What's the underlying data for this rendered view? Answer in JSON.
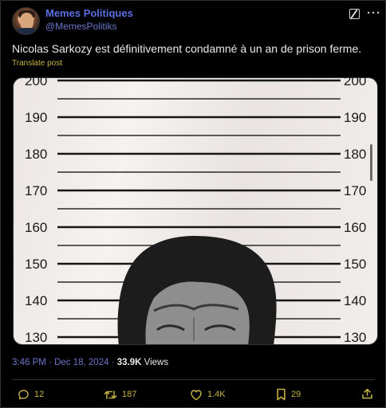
{
  "author": {
    "display_name": "Memes Politiques",
    "handle": "@MemesPolitiks"
  },
  "tweet": {
    "text": "Nicolas Sarkozy est définitivement condamné à un an de prison ferme.",
    "translate_label": "Translate post"
  },
  "media": {
    "description_icon": "mugshot-height-chart-icon",
    "height_marks": [
      {
        "label": "200",
        "value": 200
      },
      {
        "label": "190",
        "value": 190
      },
      {
        "label": "180",
        "value": 180
      },
      {
        "label": "170",
        "value": 170
      },
      {
        "label": "160",
        "value": 160
      },
      {
        "label": "150",
        "value": 150
      },
      {
        "label": "140",
        "value": 140
      },
      {
        "label": "130",
        "value": 130
      }
    ]
  },
  "meta": {
    "time": "3:46 PM",
    "separator": "·",
    "date": "Dec 18, 2024",
    "separator2": "·",
    "views_count": "33.9K",
    "views_label": "Views"
  },
  "actions": {
    "replies": "12",
    "reposts": "187",
    "likes": "1.4K",
    "bookmarks": "29"
  },
  "colors": {
    "name": "#5b6ee1",
    "accent": "#c7b341",
    "background": "#000000"
  }
}
